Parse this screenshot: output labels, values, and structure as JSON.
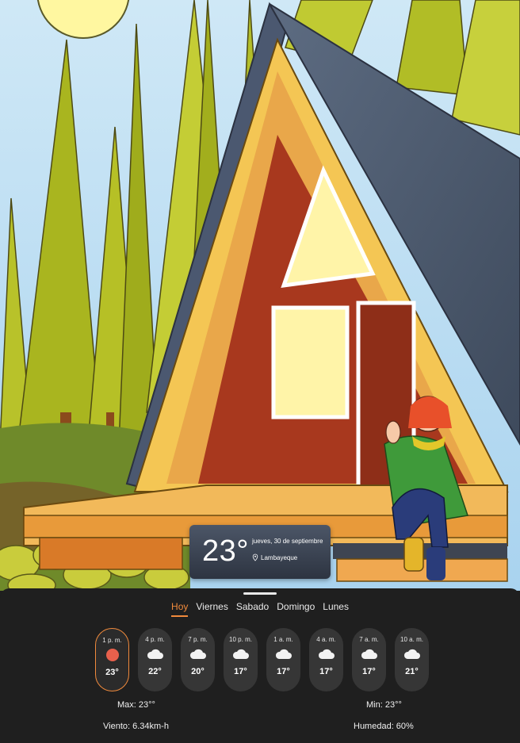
{
  "current": {
    "temperature": "23°",
    "date": "jueves, 30 de septiembre",
    "location": "Lambayeque"
  },
  "tabs": [
    {
      "label": "Hoy",
      "active": true
    },
    {
      "label": "Viernes"
    },
    {
      "label": "Sabado"
    },
    {
      "label": "Domingo"
    },
    {
      "label": "Lunes"
    }
  ],
  "hourly": [
    {
      "time": "1 p. m.",
      "temp": "23°",
      "icon": "sun-icon",
      "active": true
    },
    {
      "time": "4 p. m.",
      "temp": "22°",
      "icon": "cloud-icon"
    },
    {
      "time": "7 p. m.",
      "temp": "20°",
      "icon": "cloud-icon"
    },
    {
      "time": "10 p. m.",
      "temp": "17°",
      "icon": "cloud-icon"
    },
    {
      "time": "1 a. m.",
      "temp": "17°",
      "icon": "cloud-icon"
    },
    {
      "time": "4 a. m.",
      "temp": "17°",
      "icon": "cloud-icon"
    },
    {
      "time": "7 a. m.",
      "temp": "17°",
      "icon": "cloud-icon"
    },
    {
      "time": "10 a. m.",
      "temp": "21°",
      "icon": "cloud-icon"
    }
  ],
  "stats": {
    "max": "Max: 23°°",
    "min": "Min: 23°°",
    "wind": "Viento: 6.34km-h",
    "humidity": "Humedad: 60%"
  },
  "colors": {
    "accent": "#f08a3c",
    "panel": "#1f1f1f",
    "pill": "#363636",
    "sun": "#e8604c"
  }
}
